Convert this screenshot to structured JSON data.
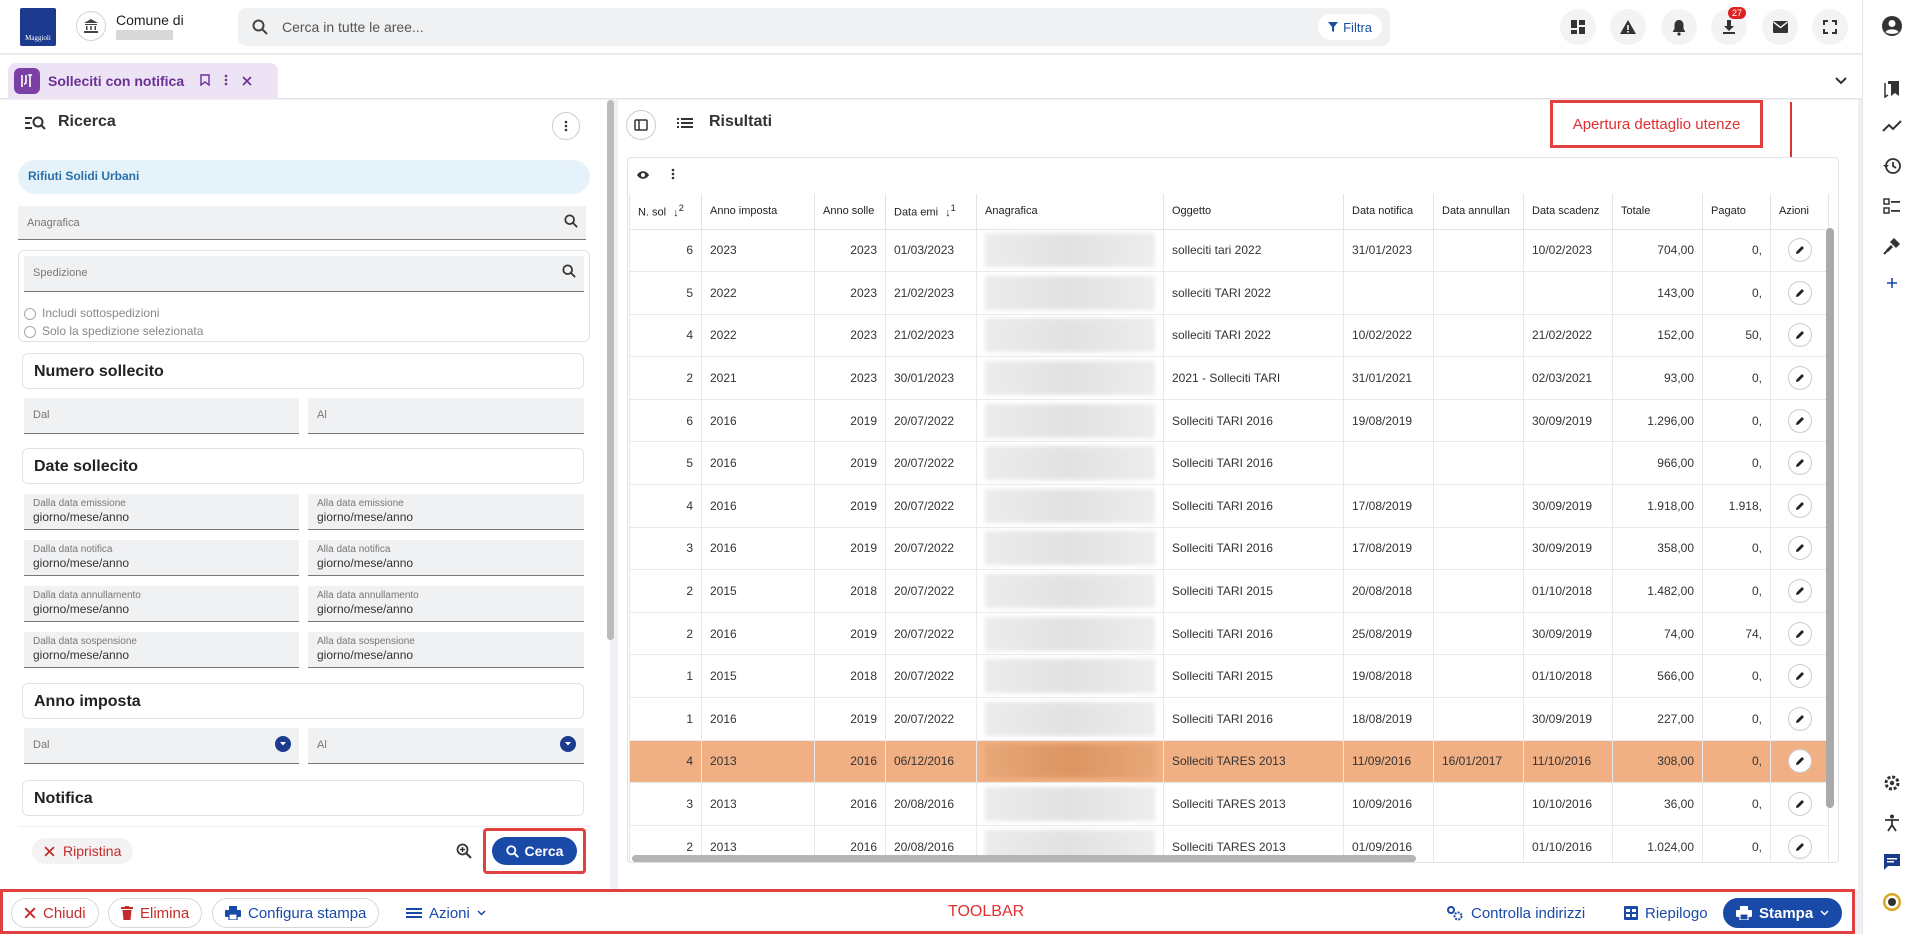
{
  "header": {
    "logo_text": "Maggioli",
    "comune_label": "Comune di",
    "search_placeholder": "Cerca in tutte le aree...",
    "filter_label": "Filtra",
    "downloads_badge": "27"
  },
  "tab": {
    "label": "Solleciti con notifica"
  },
  "search_panel": {
    "title": "Ricerca",
    "tipo": "Rifiuti Solidi Urbani",
    "anagrafica_placeholder": "Anagrafica",
    "spedizione_placeholder": "Spedizione",
    "includi_sottospedizioni": "Includi sottospedizioni",
    "solo_spedizione": "Solo la spedizione selezionata",
    "numero_sollecito": {
      "title": "Numero sollecito",
      "dal": "Dal",
      "al": "Al"
    },
    "date_sollecito": {
      "title": "Date sollecito",
      "rows": [
        {
          "left_label": "Dalla data emissione",
          "right_label": "Alla data emissione"
        },
        {
          "left_label": "Dalla data notifica",
          "right_label": "Alla data notifica"
        },
        {
          "left_label": "Dalla data annullamento",
          "right_label": "Alla data annullamento"
        },
        {
          "left_label": "Dalla data sospensione",
          "right_label": "Alla data sospensione"
        }
      ],
      "date_placeholder": "giorno/mese/anno"
    },
    "anno_imposta": {
      "title": "Anno imposta",
      "dal": "Dal",
      "al": "Al"
    },
    "notifica": {
      "title": "Notifica"
    },
    "ripristina_label": "Ripristina",
    "cerca_label": "Cerca"
  },
  "results": {
    "title": "Risultati",
    "annotation": "Apertura dettaglio utenze",
    "columns": [
      "N. sol",
      "Anno imposta",
      "Anno solle",
      "Data emi",
      "Anagrafica",
      "Oggetto",
      "Data notifica",
      "Data annullan",
      "Data scadenz",
      "Totale",
      "Pagato",
      "Azioni"
    ],
    "sort": {
      "nsol": "2",
      "dataemi": "1"
    },
    "rows": [
      {
        "nsol": "6",
        "anno_imposta": "2023",
        "anno_solle": "2023",
        "data_emi": "01/03/2023",
        "oggetto": "solleciti tari 2022",
        "data_notifica": "31/01/2023",
        "data_annull": "",
        "data_scad": "10/02/2023",
        "totale": "704,00",
        "pagato": "0,",
        "highlight": false
      },
      {
        "nsol": "5",
        "anno_imposta": "2022",
        "anno_solle": "2023",
        "data_emi": "21/02/2023",
        "oggetto": "solleciti TARI 2022",
        "data_notifica": "",
        "data_annull": "",
        "data_scad": "",
        "totale": "143,00",
        "pagato": "0,",
        "highlight": false
      },
      {
        "nsol": "4",
        "anno_imposta": "2022",
        "anno_solle": "2023",
        "data_emi": "21/02/2023",
        "oggetto": "solleciti TARI 2022",
        "data_notifica": "10/02/2022",
        "data_annull": "",
        "data_scad": "21/02/2022",
        "totale": "152,00",
        "pagato": "50,",
        "highlight": false
      },
      {
        "nsol": "2",
        "anno_imposta": "2021",
        "anno_solle": "2023",
        "data_emi": "30/01/2023",
        "oggetto": "2021 - Solleciti TARI",
        "data_notifica": "31/01/2021",
        "data_annull": "",
        "data_scad": "02/03/2021",
        "totale": "93,00",
        "pagato": "0,",
        "highlight": false
      },
      {
        "nsol": "6",
        "anno_imposta": "2016",
        "anno_solle": "2019",
        "data_emi": "20/07/2022",
        "oggetto": "Solleciti TARI 2016",
        "data_notifica": "19/08/2019",
        "data_annull": "",
        "data_scad": "30/09/2019",
        "totale": "1.296,00",
        "pagato": "0,",
        "highlight": false
      },
      {
        "nsol": "5",
        "anno_imposta": "2016",
        "anno_solle": "2019",
        "data_emi": "20/07/2022",
        "oggetto": "Solleciti TARI 2016",
        "data_notifica": "",
        "data_annull": "",
        "data_scad": "",
        "totale": "966,00",
        "pagato": "0,",
        "highlight": false
      },
      {
        "nsol": "4",
        "anno_imposta": "2016",
        "anno_solle": "2019",
        "data_emi": "20/07/2022",
        "oggetto": "Solleciti TARI 2016",
        "data_notifica": "17/08/2019",
        "data_annull": "",
        "data_scad": "30/09/2019",
        "totale": "1.918,00",
        "pagato": "1.918,",
        "highlight": false
      },
      {
        "nsol": "3",
        "anno_imposta": "2016",
        "anno_solle": "2019",
        "data_emi": "20/07/2022",
        "oggetto": "Solleciti TARI 2016",
        "data_notifica": "17/08/2019",
        "data_annull": "",
        "data_scad": "30/09/2019",
        "totale": "358,00",
        "pagato": "0,",
        "highlight": false
      },
      {
        "nsol": "2",
        "anno_imposta": "2015",
        "anno_solle": "2018",
        "data_emi": "20/07/2022",
        "oggetto": "Solleciti TARI 2015",
        "data_notifica": "20/08/2018",
        "data_annull": "",
        "data_scad": "01/10/2018",
        "totale": "1.482,00",
        "pagato": "0,",
        "highlight": false
      },
      {
        "nsol": "2",
        "anno_imposta": "2016",
        "anno_solle": "2019",
        "data_emi": "20/07/2022",
        "oggetto": "Solleciti TARI 2016",
        "data_notifica": "25/08/2019",
        "data_annull": "",
        "data_scad": "30/09/2019",
        "totale": "74,00",
        "pagato": "74,",
        "highlight": false
      },
      {
        "nsol": "1",
        "anno_imposta": "2015",
        "anno_solle": "2018",
        "data_emi": "20/07/2022",
        "oggetto": "Solleciti TARI 2015",
        "data_notifica": "19/08/2018",
        "data_annull": "",
        "data_scad": "01/10/2018",
        "totale": "566,00",
        "pagato": "0,",
        "highlight": false
      },
      {
        "nsol": "1",
        "anno_imposta": "2016",
        "anno_solle": "2019",
        "data_emi": "20/07/2022",
        "oggetto": "Solleciti TARI 2016",
        "data_notifica": "18/08/2019",
        "data_annull": "",
        "data_scad": "30/09/2019",
        "totale": "227,00",
        "pagato": "0,",
        "highlight": false
      },
      {
        "nsol": "4",
        "anno_imposta": "2013",
        "anno_solle": "2016",
        "data_emi": "06/12/2016",
        "oggetto": "Solleciti TARES 2013",
        "data_notifica": "11/09/2016",
        "data_annull": "16/01/2017",
        "data_scad": "11/10/2016",
        "totale": "308,00",
        "pagato": "0,",
        "highlight": true
      },
      {
        "nsol": "3",
        "anno_imposta": "2013",
        "anno_solle": "2016",
        "data_emi": "20/08/2016",
        "oggetto": "Solleciti TARES 2013",
        "data_notifica": "10/09/2016",
        "data_annull": "",
        "data_scad": "10/10/2016",
        "totale": "36,00",
        "pagato": "0,",
        "highlight": false
      },
      {
        "nsol": "2",
        "anno_imposta": "2013",
        "anno_solle": "2016",
        "data_emi": "20/08/2016",
        "oggetto": "Solleciti TARES 2013",
        "data_notifica": "01/09/2016",
        "data_annull": "",
        "data_scad": "01/10/2016",
        "totale": "1.024,00",
        "pagato": "0,",
        "highlight": false
      }
    ]
  },
  "toolbar": {
    "label": "TOOLBAR",
    "chiudi": "Chiudi",
    "elimina": "Elimina",
    "configura_stampa": "Configura stampa",
    "azioni": "Azioni",
    "controlla_indirizzi": "Controlla indirizzi",
    "riepilogo": "Riepilogo",
    "stampa": "Stampa"
  },
  "colors": {
    "primary": "#1a4aa8",
    "danger": "#c42b2b",
    "annotation": "#e04040",
    "highlight_row": "#f1b083",
    "tab_accent": "#7b3fa6"
  }
}
